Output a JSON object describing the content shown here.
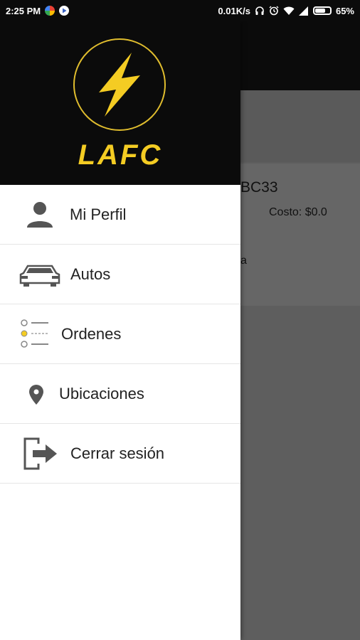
{
  "status_bar": {
    "time": "2:25 PM",
    "speed": "0.01K/s",
    "battery": "65%",
    "app_icons": [
      "photos-app-icon",
      "play-store-app-icon"
    ],
    "system_icons": [
      "headphones-icon",
      "alarm-icon",
      "wifi-icon",
      "signal-icon",
      "battery-icon"
    ]
  },
  "background_screen": {
    "code": "BC33",
    "cost": "Costo: $0.0",
    "fragment": "a"
  },
  "drawer": {
    "logo_text": "LAFC",
    "colors": {
      "accent": "#f4cc23",
      "header_bg": "#0b0b0b",
      "icon": "#555555"
    },
    "menu": [
      {
        "label": "Mi Perfil",
        "icon": "person-icon"
      },
      {
        "label": "Autos",
        "icon": "car-icon"
      },
      {
        "label": "Ordenes",
        "icon": "orders-list-icon"
      },
      {
        "label": "Ubicaciones",
        "icon": "location-pin-icon"
      },
      {
        "label": "Cerrar sesión",
        "icon": "logout-icon"
      }
    ]
  }
}
